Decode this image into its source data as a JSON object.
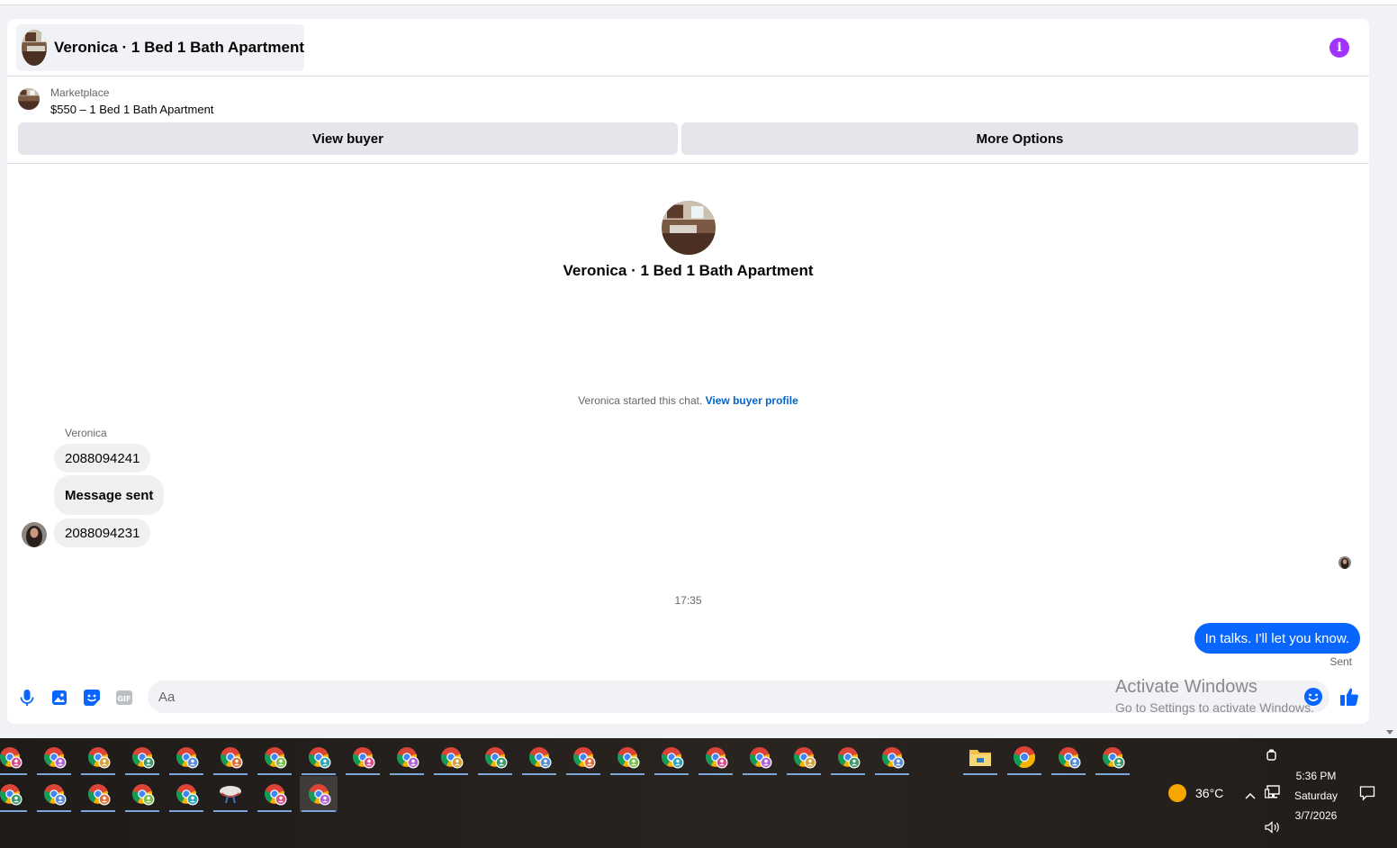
{
  "header": {
    "title": "Veronica · 1 Bed 1 Bath Apartment"
  },
  "marketplace": {
    "label": "Marketplace",
    "listing_title": "$550 – 1 Bed 1 Bath Apartment",
    "view_buyer_label": "View buyer",
    "more_options_label": "More Options"
  },
  "intro": {
    "name": "Veronica · 1 Bed 1 Bath Apartment"
  },
  "chat": {
    "started_text": "Veronica started this chat. ",
    "view_profile_link": "View buyer profile",
    "sender_name": "Veronica",
    "incoming": [
      "2088094241",
      "Message sent",
      "2088094231"
    ],
    "time_separator": "17:35",
    "outgoing": "In talks. I'll let you know.",
    "sent_status": "Sent"
  },
  "composer": {
    "placeholder": "Aa"
  },
  "watermark": {
    "line1": "Activate Windows",
    "line2": "Go to Settings to activate Windows."
  },
  "taskbar": {
    "weather": "36°C",
    "time": "5:36 PM",
    "day": "Saturday",
    "date": "3/7/2026"
  },
  "colors": {
    "accent": "#0866ff",
    "info": "#a033ff",
    "link": "#0064d1",
    "bubble_in": "#f0f0f0"
  }
}
